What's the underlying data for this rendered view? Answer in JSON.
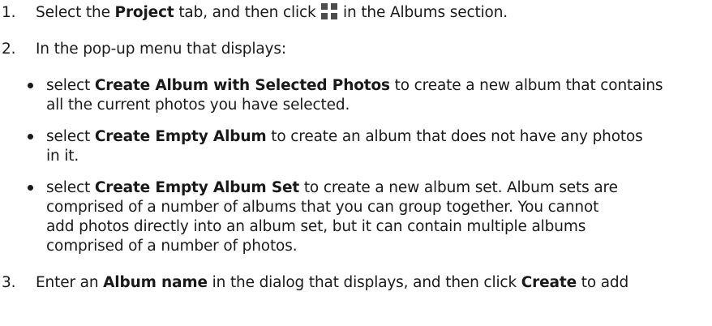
{
  "step1": {
    "number": "1.",
    "text_a": "Select the ",
    "bold_a": "Project",
    "text_b": " tab, and then click ",
    "icon": "plus-icon",
    "text_c": " in the Albums section."
  },
  "step2": {
    "number": "2.",
    "text": "In the pop-up menu that displays:"
  },
  "bullet1": {
    "text_a": "select ",
    "bold": "Create Album with Selected Photos",
    "text_b": " to create a new album that contains",
    "line2": "all the current photos you have selected."
  },
  "bullet2": {
    "text_a": "select ",
    "bold": "Create Empty Album",
    "text_b": " to create an album that does not have any photos",
    "line2": "in it."
  },
  "bullet3": {
    "text_a": "select ",
    "bold": "Create Empty Album Set",
    "text_b": " to create a new album set. Album sets are",
    "line2": "comprised of a number of albums that you can group together. You cannot",
    "line3": "add photos directly into an album set, but it can contain multiple albums",
    "line4": "comprised of a number of photos."
  },
  "step3": {
    "number": "3.",
    "text_a": "Enter an ",
    "bold_a": "Album name",
    "text_b": " in the dialog that displays, and then click ",
    "bold_b": "Create",
    "text_c": " to add"
  }
}
